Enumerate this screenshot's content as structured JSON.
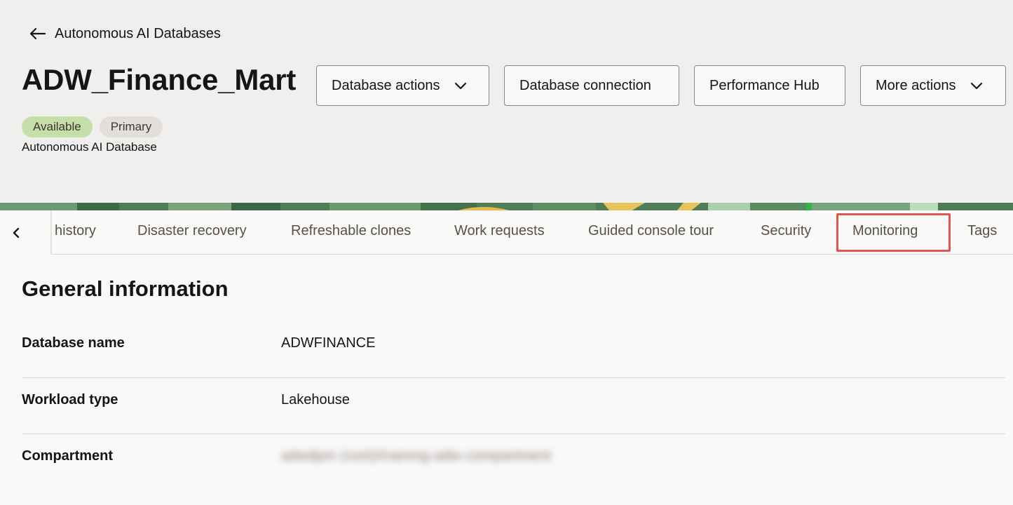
{
  "breadcrumb": {
    "back_label": "Autonomous AI Databases"
  },
  "page": {
    "title": "ADW_Finance_Mart",
    "status_badge": "Available",
    "role_badge": "Primary",
    "subtitle": "Autonomous AI Database"
  },
  "actions": {
    "database_actions": "Database actions",
    "database_connection": "Database connection",
    "performance_hub": "Performance Hub",
    "more_actions": "More actions"
  },
  "tabs": [
    {
      "label": "history"
    },
    {
      "label": "Disaster recovery"
    },
    {
      "label": "Refreshable clones"
    },
    {
      "label": "Work requests"
    },
    {
      "label": "Guided console tour"
    },
    {
      "label": "Security"
    },
    {
      "label": "Monitoring",
      "highlighted": true
    },
    {
      "label": "Tags"
    }
  ],
  "general_information": {
    "title": "General information",
    "rows": [
      {
        "label": "Database name",
        "value": "ADWFINANCE"
      },
      {
        "label": "Workload type",
        "value": "Lakehouse"
      },
      {
        "label": "Compartment",
        "value": "adwdpm (root)/training-adw-compartment"
      }
    ]
  },
  "colors": {
    "header_bg": "#f1efed",
    "available_badge": "#c5dfa8",
    "primary_badge": "#e2dfdb",
    "highlight_box": "#e2554f"
  },
  "icons": {
    "back": "arrow-left-icon",
    "dropdown": "chevron-down-icon",
    "tab_scroll_left": "chevron-left-icon"
  }
}
